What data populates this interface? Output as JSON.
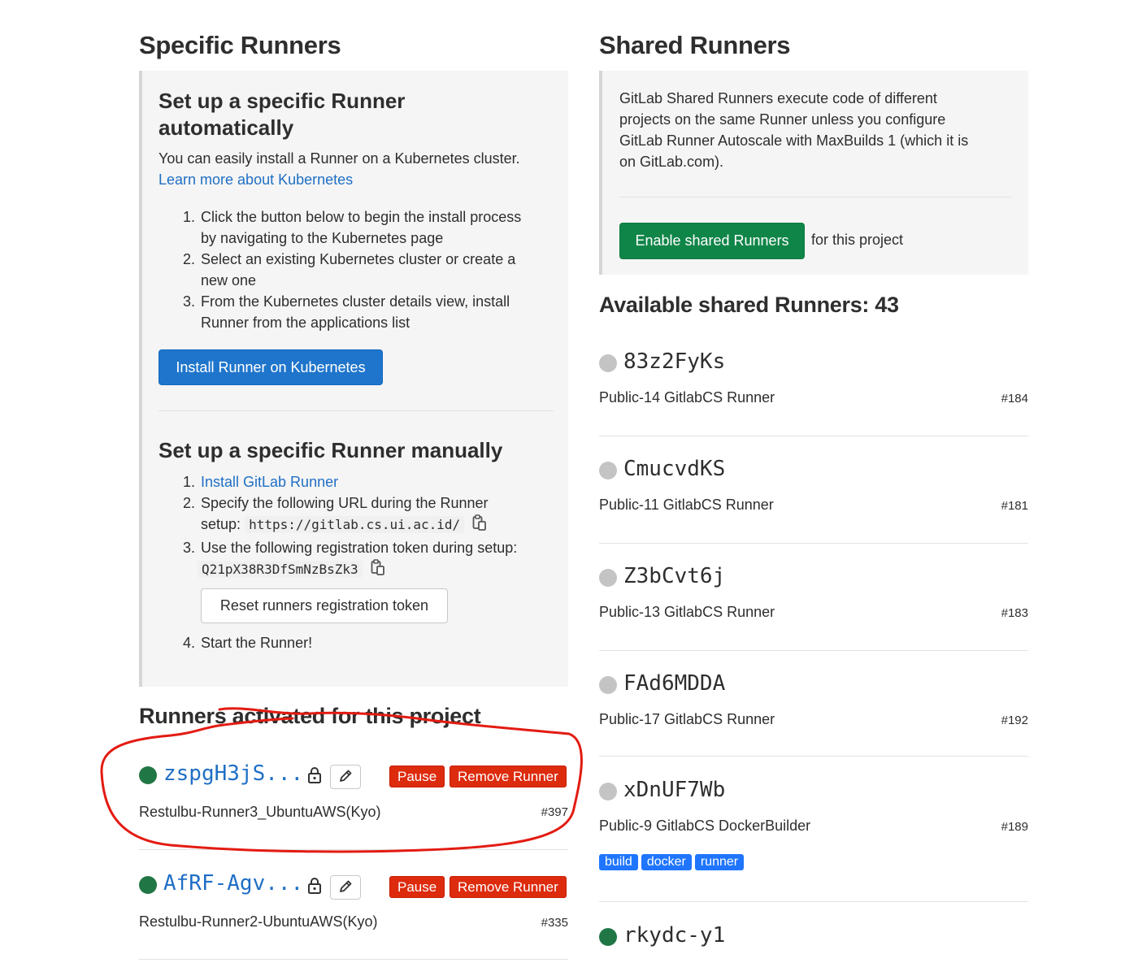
{
  "specific": {
    "title": "Specific Runners",
    "auto": {
      "heading_line1": "Set up a specific Runner",
      "heading_line2": "automatically",
      "desc": "You can easily install a Runner on a Kubernetes cluster.",
      "learn_more": "Learn more about Kubernetes",
      "steps": [
        {
          "num": "1.",
          "line1": "Click the button below to begin the install process",
          "line2": "by navigating to the Kubernetes page"
        },
        {
          "num": "2.",
          "line1": "Select an existing Kubernetes cluster or create a",
          "line2": "new one"
        },
        {
          "num": "3.",
          "line1": "From the Kubernetes cluster details view, install",
          "line2": "Runner from the applications list"
        }
      ],
      "install_button": "Install Runner on Kubernetes"
    },
    "manual": {
      "heading": "Set up a specific Runner manually",
      "step1_num": "1.",
      "step1_link": "Install GitLab Runner",
      "step2_num": "2.",
      "step2_line1": "Specify the following URL during the Runner",
      "step2_prefix": "setup:",
      "url": "https://gitlab.cs.ui.ac.id/",
      "step3_num": "3.",
      "step3_line1": "Use the following registration token during setup:",
      "token": "Q21pX38R3DfSmNzBsZk3",
      "reset_button": "Reset runners registration token",
      "step4_num": "4.",
      "step4_text": "Start the Runner!"
    },
    "activated": {
      "title": "Runners activated for this project",
      "runners": [
        {
          "name": "zspgH3jS...",
          "desc": "Restulbu-Runner3_UbuntuAWS(Kyo)",
          "id": "#397",
          "pause": "Pause",
          "remove": "Remove Runner"
        },
        {
          "name": "AfRF-Agv...",
          "desc": "Restulbu-Runner2-UbuntuAWS(Kyo)",
          "id": "#335",
          "pause": "Pause",
          "remove": "Remove Runner"
        }
      ]
    }
  },
  "shared": {
    "title": "Shared Runners",
    "info_lines": [
      "GitLab Shared Runners execute code of different",
      "projects on the same Runner unless you configure",
      "GitLab Runner Autoscale with MaxBuilds 1 (which it is",
      "on GitLab.com)."
    ],
    "enable_button": "Enable shared Runners",
    "enable_suffix": "for this project",
    "available_title": "Available shared Runners: 43",
    "runners": [
      {
        "name": "83z2FyKs",
        "desc": "Public-14 GitlabCS Runner",
        "id": "#184",
        "status": "grey"
      },
      {
        "name": "CmucvdKS",
        "desc": "Public-11 GitlabCS Runner",
        "id": "#181",
        "status": "grey"
      },
      {
        "name": "Z3bCvt6j",
        "desc": "Public-13 GitlabCS Runner",
        "id": "#183",
        "status": "grey"
      },
      {
        "name": "FAd6MDDA",
        "desc": "Public-17 GitlabCS Runner",
        "id": "#192",
        "status": "grey"
      },
      {
        "name": "xDnUF7Wb",
        "desc": "Public-9 GitlabCS DockerBuilder",
        "id": "#189",
        "status": "grey",
        "tags": [
          "build",
          "docker",
          "runner"
        ]
      },
      {
        "name": "rkydc-y1",
        "status": "green"
      }
    ]
  },
  "colors": {
    "link": "#1f6fc5",
    "green": "#108548",
    "blue_button": "#1f75cb",
    "red_button": "#dd2b0e",
    "online_dot": "#217645",
    "offline_dot": "#c4c4c4",
    "annotation_red": "#e31b12"
  }
}
